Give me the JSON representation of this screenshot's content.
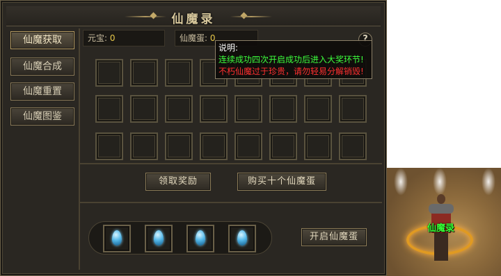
{
  "window": {
    "title": "仙魔录"
  },
  "sidebar": {
    "items": [
      {
        "label": "仙魔获取"
      },
      {
        "label": "仙魔合成"
      },
      {
        "label": "仙魔重置"
      },
      {
        "label": "仙魔图鉴"
      }
    ]
  },
  "currency": {
    "yuanbao_label": "元宝:",
    "yuanbao_value": "0",
    "egg_label": "仙魔蛋:",
    "egg_value": "0"
  },
  "help": {
    "icon_glyph": "?"
  },
  "tooltip": {
    "title": "说明:",
    "line1": "连续成功四次开启成功后进入大奖环节!",
    "line2": "不朽仙魔过于珍贵，请勿轻易分解销毁!"
  },
  "actions": {
    "claim_reward": "领取奖励",
    "buy_ten_eggs": "购买十个仙魔蛋",
    "open_egg": "开启仙魔蛋"
  },
  "egg_tray": {
    "egg_count": 4
  },
  "scene": {
    "character_label": "仙魔录"
  },
  "colors": {
    "tooltip_green": "#3cff3c",
    "tooltip_red": "#ff3030",
    "currency_value": "#e8c94a",
    "character_label": "#36ff36"
  }
}
